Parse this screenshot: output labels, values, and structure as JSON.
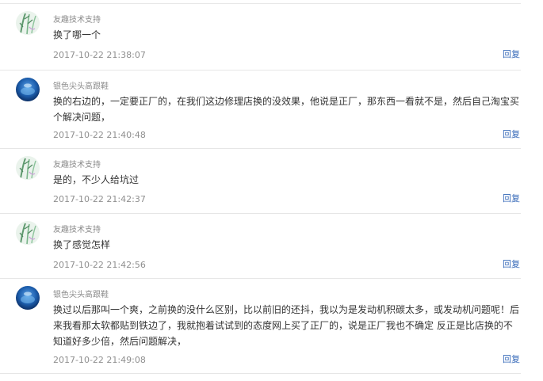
{
  "colors": {
    "reply_link": "#3568b8",
    "username": "#8a8a8a",
    "content": "#333333",
    "divider": "#e6e6e6"
  },
  "comments": [
    {
      "avatar_icon": "bamboo-avatar-icon",
      "username": "友趣技术支持",
      "content": "换了哪一个",
      "time": "2017-10-22 21:38:07",
      "reply_label": "回复"
    },
    {
      "avatar_icon": "blue-sphere-avatar-icon",
      "username": "银色尖头高跟鞋",
      "content": "换的右边的，一定要正厂的，在我们这边修理店换的没效果，他说是正厂，那东西一看就不是，然后自己淘宝买个解决问题，",
      "time": "2017-10-22 21:40:48",
      "reply_label": "回复"
    },
    {
      "avatar_icon": "bamboo-avatar-icon",
      "username": "友趣技术支持",
      "content": "是的，不少人给坑过",
      "time": "2017-10-22 21:42:37",
      "reply_label": "回复"
    },
    {
      "avatar_icon": "bamboo-avatar-icon",
      "username": "友趣技术支持",
      "content": "换了感觉怎样",
      "time": "2017-10-22 21:42:56",
      "reply_label": "回复"
    },
    {
      "avatar_icon": "blue-sphere-avatar-icon",
      "username": "银色尖头高跟鞋",
      "content": "换过以后那叫一个爽，之前换的没什么区别，比以前旧的还抖，我以为是发动机积碳太多，或发动机问题呢！后来我看那太软都贴到铁边了，我就抱着试试到的态度网上买了正厂的，说是正厂我也不确定 反正是比店换的不知道好多少倍，然后问题解决，",
      "time": "2017-10-22 21:49:08",
      "reply_label": "回复"
    }
  ]
}
